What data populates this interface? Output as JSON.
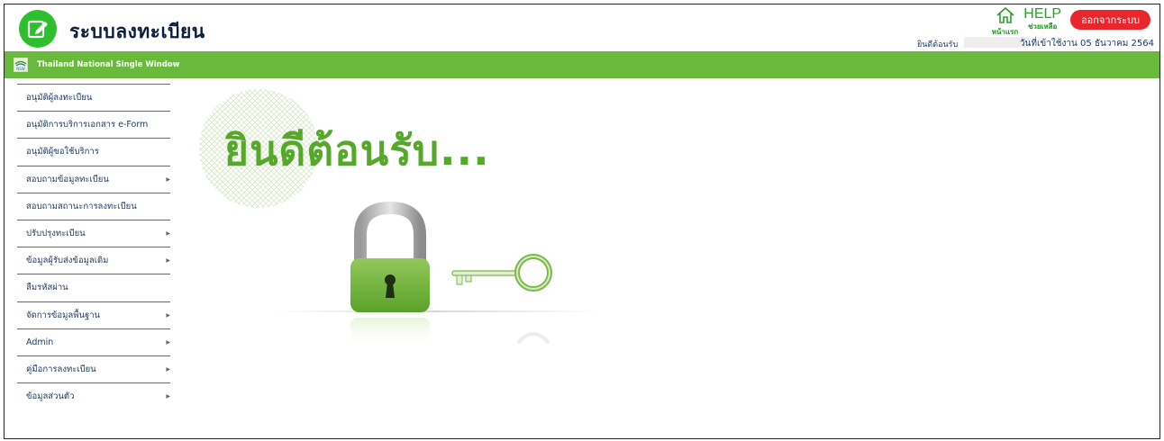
{
  "app": {
    "title": "ระบบลงทะเบียน"
  },
  "header": {
    "home_label": "หน้าแรก",
    "help_text": "HELP",
    "help_label": "ช่วยเหลือ",
    "logout_label": "ออกจากระบบ",
    "welcome_label": "ยินดีต้อนรับ",
    "date_text": "วันที่เข้าใช้งาน 05 ธันวาคม 2564"
  },
  "greenbar": {
    "title": "Thailand National Single Window",
    "logo_label": "NSW"
  },
  "sidebar": {
    "items": [
      {
        "label": "อนุมัติผู้ลงทะเบียน",
        "has_arrow": false
      },
      {
        "label": "อนุมัติการบริการเอกสาร e-Form",
        "has_arrow": false
      },
      {
        "label": "อนุมัติผู้ขอใช้บริการ",
        "has_arrow": false
      },
      {
        "label": "สอบถามข้อมูลทะเบียน",
        "has_arrow": true
      },
      {
        "label": "สอบถามสถานะการลงทะเบียน",
        "has_arrow": false
      },
      {
        "label": "ปรับปรุงทะเบียน",
        "has_arrow": true
      },
      {
        "label": "ข้อมูลผู้รับส่งข้อมูลเดิม",
        "has_arrow": true
      },
      {
        "label": "ลืมรหัสผ่าน",
        "has_arrow": false
      },
      {
        "label": "จัดการข้อมูลพื้นฐาน",
        "has_arrow": true
      },
      {
        "label": "Admin",
        "has_arrow": true
      },
      {
        "label": "คู่มือการลงทะเบียน",
        "has_arrow": true
      },
      {
        "label": "ข้อมูลส่วนตัว",
        "has_arrow": true
      }
    ]
  },
  "main": {
    "welcome_text": "ยินดีต้อนรับ..."
  },
  "colors": {
    "brand_green": "#69ba3c",
    "logout_red": "#e8262b",
    "title_navy": "#0b1d3a"
  },
  "icons": {
    "logo": "edit-icon",
    "home": "home-icon",
    "lock": "padlock-icon",
    "key": "key-icon"
  }
}
